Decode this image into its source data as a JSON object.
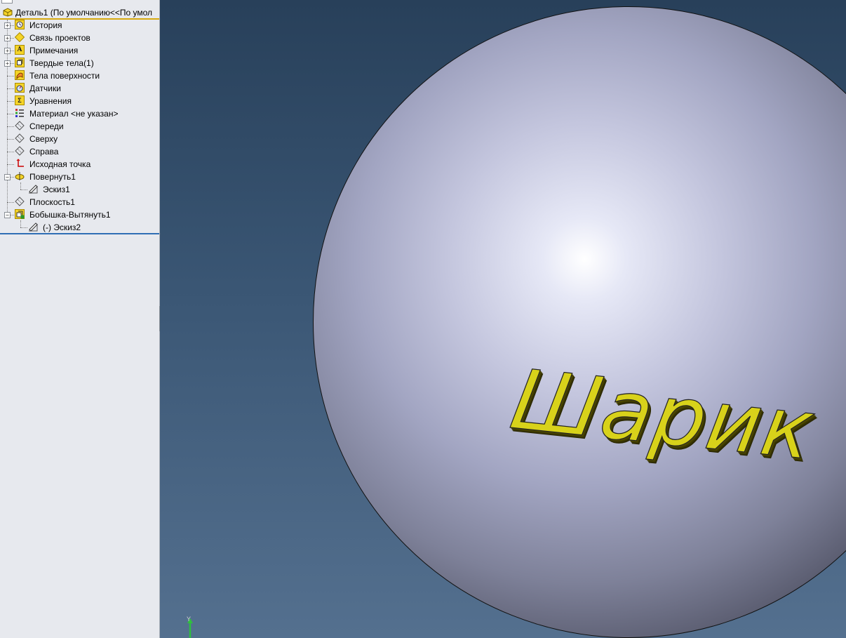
{
  "feature_tree": {
    "root_label": "Деталь1  (По умолчанию<<По умол",
    "items": [
      {
        "label": "История",
        "icon": "history-icon"
      },
      {
        "label": "Связь проектов",
        "icon": "design-binder-icon"
      },
      {
        "label": "Примечания",
        "icon": "annotations-icon"
      },
      {
        "label": "Твердые тела(1)",
        "icon": "solid-bodies-icon"
      },
      {
        "label": "Тела поверхности",
        "icon": "surface-bodies-icon"
      },
      {
        "label": "Датчики",
        "icon": "sensors-icon"
      },
      {
        "label": "Уравнения",
        "icon": "equations-icon"
      },
      {
        "label": "Материал <не указан>",
        "icon": "material-icon"
      },
      {
        "label": "Спереди",
        "icon": "plane-icon"
      },
      {
        "label": "Сверху",
        "icon": "plane-icon"
      },
      {
        "label": "Справа",
        "icon": "plane-icon"
      },
      {
        "label": "Исходная точка",
        "icon": "origin-icon"
      },
      {
        "label": "Повернуть1",
        "icon": "revolve-icon"
      },
      {
        "label": "Эскиз1",
        "icon": "sketch-icon"
      },
      {
        "label": "Плоскость1",
        "icon": "plane-icon"
      },
      {
        "label": "Бобышка-Вытянуть1",
        "icon": "extrude-icon"
      },
      {
        "label": "(-) Эскиз2",
        "icon": "sketch-icon"
      }
    ]
  },
  "viewport": {
    "model_text": "Шарик",
    "triad_label": "Y"
  },
  "colors": {
    "panel_bg": "#e7e9ee",
    "root_underline": "#d7a90f",
    "rollback_bar": "#2f6fb5",
    "viewport_top": "#28405a",
    "viewport_bottom": "#54708f",
    "text_color": "#d8d21a"
  }
}
